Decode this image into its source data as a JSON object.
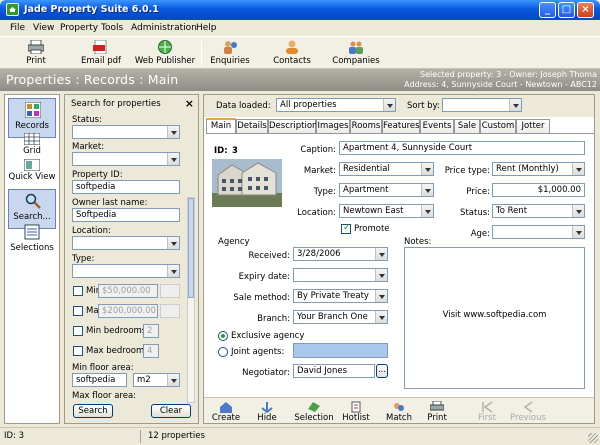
{
  "window": {
    "title": "Jade Property Suite 6.0.1"
  },
  "menu": [
    "File",
    "View",
    "Property",
    "Tools",
    "Administration",
    "Help"
  ],
  "toolbar": [
    "Print",
    "Email pdf",
    "Web Publisher",
    "Enquiries",
    "Contacts",
    "Companies"
  ],
  "header": {
    "breadcrumb": "Properties : Records : Main",
    "selected_line1": "Selected property: 3 - Owner: Joseph Thoma",
    "selected_line2": "Address: 4, Sunnyside Court - Newtown - ABC12"
  },
  "nav": [
    "Records",
    "Grid",
    "Quick View",
    "Search...",
    "Selections"
  ],
  "search": {
    "title": "Search for properties",
    "status_label": "Status:",
    "market_label": "Market:",
    "property_id_label": "Property ID:",
    "property_id_value": "softpedia",
    "owner_label": "Owner last name:",
    "owner_value": "Softpedia",
    "location_label": "Location:",
    "type_label": "Type:",
    "min_label": "Min",
    "min_value": "$50,000.00",
    "max_label": "Ma",
    "max_value": "$200,000.00",
    "min_bedrooms_label": "Min bedrooms",
    "min_bedrooms_value": "2",
    "max_bedrooms_label": "Max bedrooms",
    "max_bedrooms_value": "4",
    "min_floor_label": "Min floor area:",
    "min_floor_value": "softpedia",
    "min_floor_unit": "m2",
    "max_floor_label": "Max floor area:",
    "search_button": "Search",
    "clear_button": "Clear"
  },
  "main": {
    "data_loaded_label": "Data loaded:",
    "data_loaded_value": "All properties",
    "sort_by_label": "Sort by:",
    "tabs": [
      "Main",
      "Details",
      "Description",
      "Images",
      "Rooms",
      "Features",
      "Events",
      "Sale",
      "Custom",
      "Jotter"
    ],
    "id_label": "ID:",
    "id_value": "3",
    "caption_label": "Caption:",
    "caption_value": "Apartment 4, Sunnyside Court",
    "market_label": "Market:",
    "market_value": "Residential",
    "type_label": "Type:",
    "type_value": "Apartment",
    "location_label": "Location:",
    "location_value": "Newtown East",
    "promote_label": "Promote",
    "price_type_label": "Price type:",
    "price_type_value": "Rent (Monthly)",
    "price_label": "Price:",
    "price_value": "$1,000.00",
    "status_label": "Status:",
    "status_value": "To Rent",
    "age_label": "Age:",
    "agency_label": "Agency",
    "received_label": "Received:",
    "received_value": "3/28/2006",
    "expiry_label": "Expiry date:",
    "sale_method_label": "Sale method:",
    "sale_method_value": "By Private Treaty",
    "branch_label": "Branch:",
    "branch_value": "Your Branch One",
    "exclusive_label": "Exclusive agency",
    "joint_label": "Joint agents:",
    "negotiator_label": "Negotiator:",
    "negotiator_value": "David Jones",
    "notes_label": "Notes:",
    "notes_text": "Visit www.softpedia.com",
    "bottom_buttons": [
      "Create",
      "Hide",
      "Selection",
      "Hotlist",
      "Match",
      "Print",
      "First",
      "Previous"
    ]
  },
  "status": {
    "left": "ID: 3",
    "count": "12 properties"
  }
}
